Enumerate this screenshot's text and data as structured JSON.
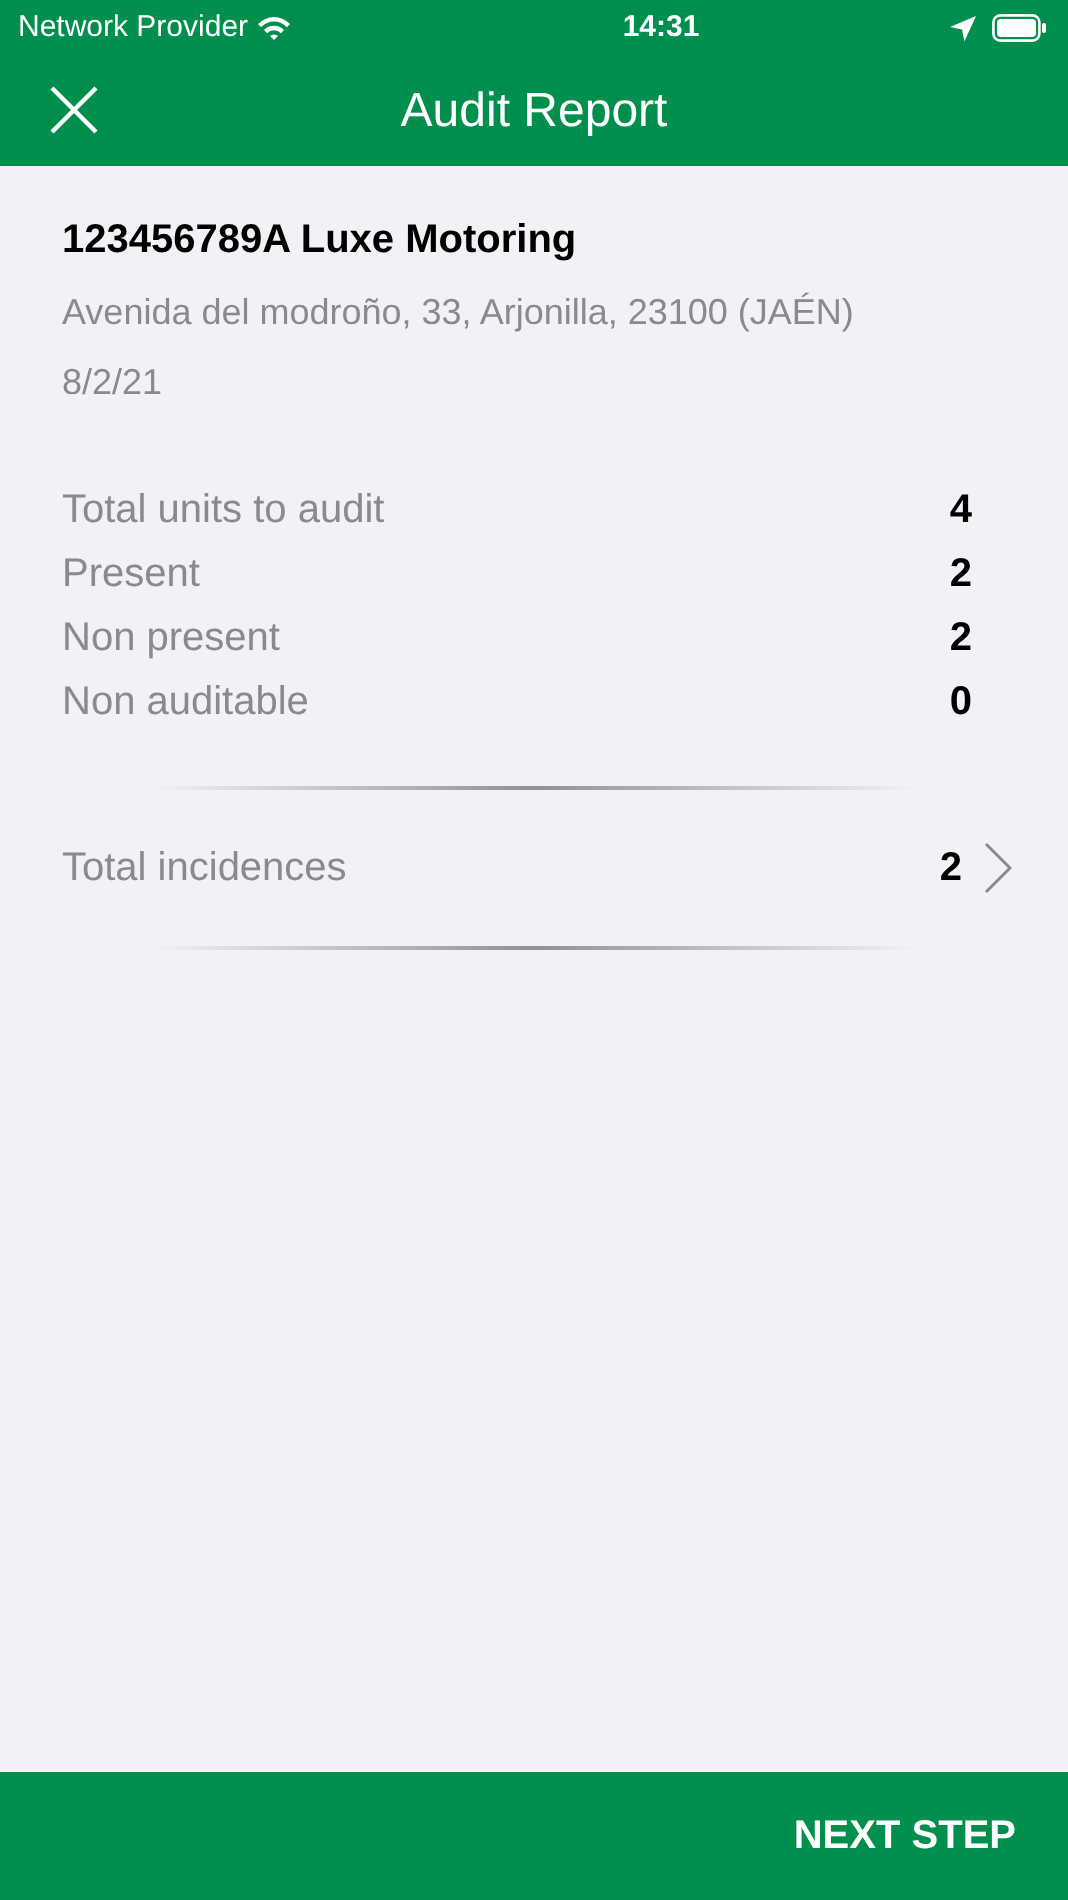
{
  "status_bar": {
    "carrier": "Network Provider",
    "time": "14:31"
  },
  "header": {
    "title": "Audit Report"
  },
  "dealer": {
    "name": "123456789A Luxe Motoring",
    "address": "Avenida del modroño, 33, Arjonilla, 23100 (JAÉN)",
    "date": "8/2/21"
  },
  "stats": [
    {
      "label": "Total units to audit",
      "value": "4"
    },
    {
      "label": "Present",
      "value": "2"
    },
    {
      "label": "Non present",
      "value": "2"
    },
    {
      "label": "Non auditable",
      "value": "0"
    }
  ],
  "incidences": {
    "label": "Total incidences",
    "value": "2"
  },
  "footer": {
    "button": "NEXT STEP"
  }
}
